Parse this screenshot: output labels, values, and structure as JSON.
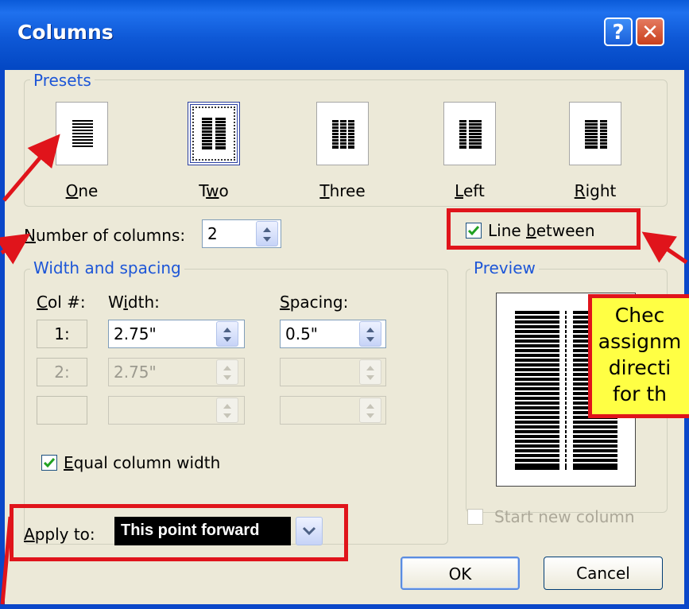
{
  "window": {
    "title": "Columns",
    "help_glyph": "?",
    "close_glyph": "✕"
  },
  "presets": {
    "legend": "Presets",
    "items": [
      {
        "key": "one",
        "label": "One",
        "mnemonic": "O",
        "rest": "ne",
        "selected": false
      },
      {
        "key": "two",
        "label": "Two",
        "mnemonic": "w",
        "selected": true
      },
      {
        "key": "three",
        "label": "Three",
        "mnemonic": "T",
        "selected": false
      },
      {
        "key": "left",
        "label": "Left",
        "mnemonic": "L",
        "selected": false
      },
      {
        "key": "right",
        "label": "Right",
        "mnemonic": "R",
        "selected": false
      }
    ]
  },
  "number_of_columns": {
    "label_pre": "",
    "label_u": "N",
    "label_rest": "umber of columns:",
    "value": "2"
  },
  "line_between": {
    "label_pre": "Line ",
    "label_u": "b",
    "label_rest": "etween",
    "checked": true
  },
  "width_spacing": {
    "legend": "Width and spacing",
    "col_header_u": "C",
    "col_header_rest": "ol #:",
    "width_header_pre": "W",
    "width_header_u": "i",
    "width_header_rest": "dth:",
    "spacing_header_u": "S",
    "spacing_header_rest": "pacing:",
    "rows": [
      {
        "col": "1:",
        "width": "2.75\"",
        "spacing": "0.5\"",
        "enabled": true
      },
      {
        "col": "2:",
        "width": "2.75\"",
        "spacing": "",
        "enabled": false
      },
      {
        "col": "",
        "width": "",
        "spacing": "",
        "enabled": false
      }
    ]
  },
  "equal_width": {
    "label_u": "E",
    "label_rest": "qual column width",
    "checked": true
  },
  "apply_to": {
    "label_u": "A",
    "label_rest": "pply to:",
    "value": "This point forward"
  },
  "preview": {
    "legend": "Preview"
  },
  "start_new_column": {
    "label": "Start new column",
    "checked": false
  },
  "buttons": {
    "ok": "OK",
    "cancel": "Cancel"
  },
  "callout": {
    "lines": [
      "Chec",
      "assignm",
      "directi",
      "for th"
    ]
  },
  "colors": {
    "annotation_red": "#e0141b",
    "callout_yellow": "#ffff44",
    "title_blue": "#0a5ad8",
    "legend_blue": "#1d56d7"
  }
}
